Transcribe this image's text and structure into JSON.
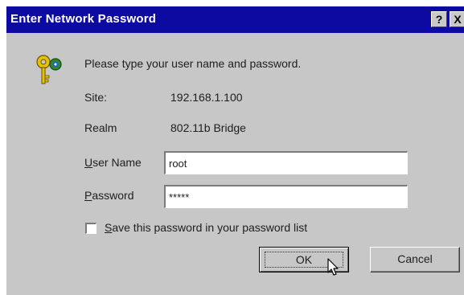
{
  "window": {
    "title": "Enter Network Password",
    "help_label": "?",
    "close_label": "X"
  },
  "prompt": "Please type your user name and password.",
  "site": {
    "label": "Site:",
    "value": "192.168.1.100"
  },
  "realm": {
    "label": "Realm",
    "value": "802.11b Bridge"
  },
  "username": {
    "label_accel": "U",
    "label_rest": "ser Name",
    "value": "root"
  },
  "password": {
    "label_accel": "P",
    "label_rest": "assword",
    "value": "*****"
  },
  "save_password": {
    "label_accel": "S",
    "label_rest": "ave this password in your password list",
    "checked": false
  },
  "buttons": {
    "ok": "OK",
    "cancel": "Cancel"
  },
  "icons": {
    "dialog": "keys-icon",
    "pointer": "mouse-cursor-icon"
  },
  "colors": {
    "titlebar": "#0c0aa0",
    "dialog_bg": "#c7c7c7"
  }
}
